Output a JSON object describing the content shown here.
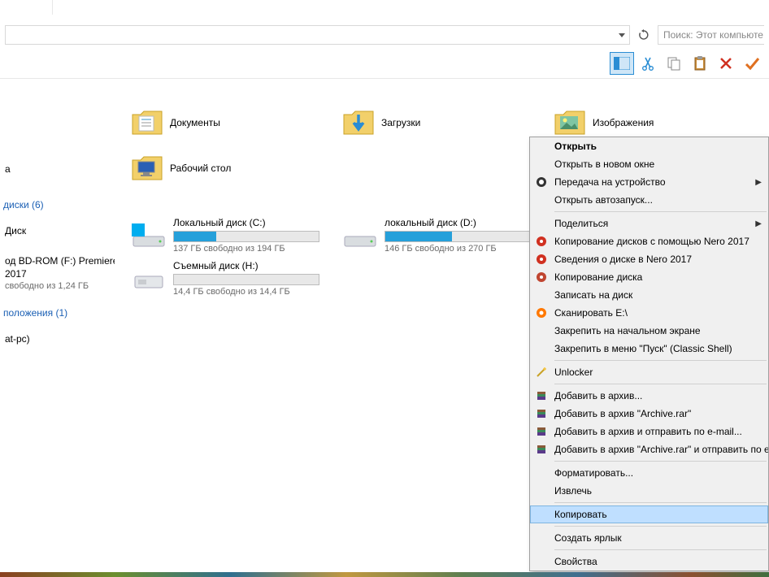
{
  "address_bar": {
    "value": ""
  },
  "search": {
    "placeholder": "Поиск: Этот компьюте"
  },
  "toolbar_icons": [
    "panel",
    "cut",
    "copy",
    "paste",
    "delete",
    "apply"
  ],
  "sidebar": {
    "groups": [
      {
        "label": "диски (6)",
        "type": "group"
      },
      {
        "label": "Диск",
        "type": "item"
      },
      {
        "label_line1": "од ВD-ROM (F:) Premiere",
        "label_line2": "2017",
        "label_line3": "свободно из 1,24 ГБ",
        "type": "multi"
      },
      {
        "label": "положения (1)",
        "type": "group"
      },
      {
        "label": "at-pc)",
        "type": "item"
      }
    ]
  },
  "fragment_label": "а",
  "folders": [
    {
      "name": "Документы",
      "icon": "docs"
    },
    {
      "name": "Загрузки",
      "icon": "downloads"
    },
    {
      "name": "Изображения",
      "icon": "images"
    },
    {
      "name": "Рабочий стол",
      "icon": "desktop"
    }
  ],
  "drives": [
    {
      "name": "Локальный диск (C:)",
      "free_text": "137 ГБ свободно из 194 ГБ",
      "fill_pct": 29,
      "icon": "hdd-win"
    },
    {
      "name": "локальный диск  (D:)",
      "free_text": "146 ГБ свободно из 270 ГБ",
      "fill_pct": 46,
      "icon": "hdd"
    },
    {
      "name": "Съемный диск (H:)",
      "free_text": "14,4 ГБ свободно из 14,4 ГБ",
      "fill_pct": 0,
      "icon": "removable"
    }
  ],
  "context_menu": {
    "groups": [
      [
        {
          "label": "Открыть",
          "bold": true
        },
        {
          "label": "Открыть в новом окне"
        },
        {
          "label": "Передача на устройство",
          "icon": "cast",
          "arrow": true
        },
        {
          "label": "Открыть автозапуск..."
        }
      ],
      [
        {
          "label": "Поделиться",
          "arrow": true
        },
        {
          "label": "Копирование дисков с помощью Nero 2017",
          "icon": "nero-red"
        },
        {
          "label": "Сведения о диске в Nero 2017",
          "icon": "nero-red"
        },
        {
          "label": "Копирование диска",
          "icon": "nero-red2"
        },
        {
          "label": "Записать на диск"
        },
        {
          "label": "Сканировать E:\\",
          "icon": "avast"
        },
        {
          "label": "Закрепить на начальном экране"
        },
        {
          "label": "Закрепить в меню \"Пуск\" (Classic Shell)"
        }
      ],
      [
        {
          "label": "Unlocker",
          "icon": "wand"
        }
      ],
      [
        {
          "label": "Добавить в архив...",
          "icon": "rar"
        },
        {
          "label": "Добавить в архив \"Archive.rar\"",
          "icon": "rar"
        },
        {
          "label": "Добавить в архив и отправить по e-mail...",
          "icon": "rar"
        },
        {
          "label": "Добавить в архив \"Archive.rar\" и отправить по e-",
          "icon": "rar"
        }
      ],
      [
        {
          "label": "Форматировать..."
        },
        {
          "label": "Извлечь"
        }
      ],
      [
        {
          "label": "Копировать",
          "hover": true
        }
      ],
      [
        {
          "label": "Создать ярлык"
        }
      ],
      [
        {
          "label": "Свойства"
        }
      ]
    ]
  }
}
